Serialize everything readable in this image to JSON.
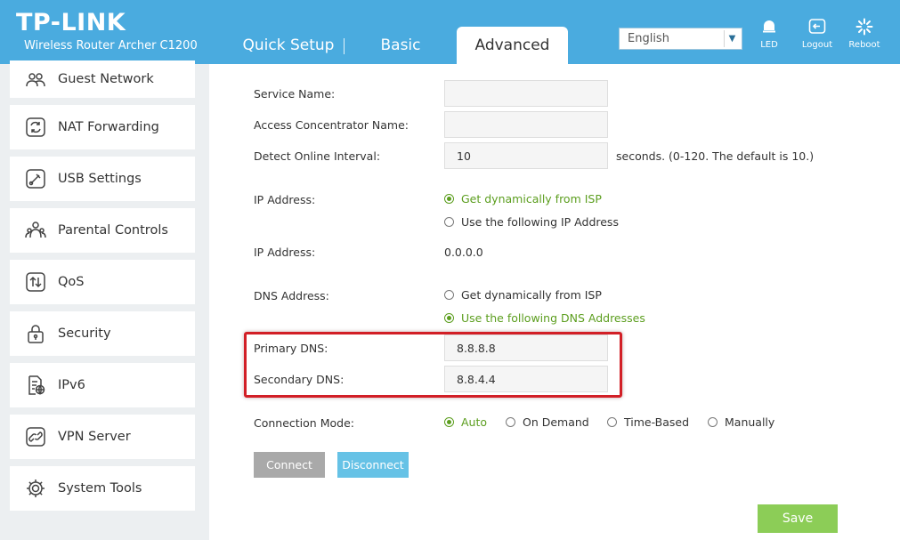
{
  "header": {
    "logo": "TP-LINK",
    "model": "Wireless Router Archer C1200",
    "tabs": [
      {
        "label": "Quick Setup"
      },
      {
        "label": "Basic"
      },
      {
        "label": "Advanced"
      }
    ],
    "language": "English",
    "icons": [
      {
        "label": "LED",
        "icon": "led-bell-icon"
      },
      {
        "label": "Logout",
        "icon": "logout-icon"
      },
      {
        "label": "Reboot",
        "icon": "reboot-icon"
      }
    ]
  },
  "sidebar": {
    "items": [
      {
        "label": "Guest Network",
        "icon": "guest-network-icon"
      },
      {
        "label": "NAT Forwarding",
        "icon": "nat-forwarding-icon"
      },
      {
        "label": "USB Settings",
        "icon": "usb-icon"
      },
      {
        "label": "Parental Controls",
        "icon": "parental-controls-icon"
      },
      {
        "label": "QoS",
        "icon": "qos-icon"
      },
      {
        "label": "Security",
        "icon": "lock-icon"
      },
      {
        "label": "IPv6",
        "icon": "ipv6-icon"
      },
      {
        "label": "VPN Server",
        "icon": "vpn-icon"
      },
      {
        "label": "System Tools",
        "icon": "gear-icon"
      }
    ]
  },
  "form": {
    "service_name": {
      "label": "Service Name:",
      "value": ""
    },
    "access_concentrator": {
      "label": "Access Concentrator Name:",
      "value": ""
    },
    "detect_interval": {
      "label": "Detect Online Interval:",
      "value": "10",
      "hint": "seconds. (0-120. The default is 10.)"
    },
    "ip_address_mode": {
      "label": "IP Address:",
      "options": [
        "Get dynamically from ISP",
        "Use the following IP Address"
      ],
      "selected": "Get dynamically from ISP"
    },
    "ip_address": {
      "label": "IP Address:",
      "value": "0.0.0.0"
    },
    "dns_mode": {
      "label": "DNS Address:",
      "options": [
        "Get dynamically from ISP",
        "Use the following DNS Addresses"
      ],
      "selected": "Use the following DNS Addresses"
    },
    "primary_dns": {
      "label": "Primary DNS:",
      "value": "8.8.8.8"
    },
    "secondary_dns": {
      "label": "Secondary DNS:",
      "value": "8.8.4.4"
    },
    "connection_mode": {
      "label": "Connection Mode:",
      "options": [
        "Auto",
        "On Demand",
        "Time-Based",
        "Manually"
      ],
      "selected": "Auto"
    }
  },
  "buttons": {
    "connect": "Connect",
    "disconnect": "Disconnect",
    "save": "Save"
  },
  "colors": {
    "header": "#4aabdf",
    "selected_radio": "#5c9e1f",
    "highlight_box": "#d21f26",
    "save_button": "#8ccd57",
    "disconnect_button": "#66c2e6",
    "connect_button": "#a9a9a9"
  }
}
